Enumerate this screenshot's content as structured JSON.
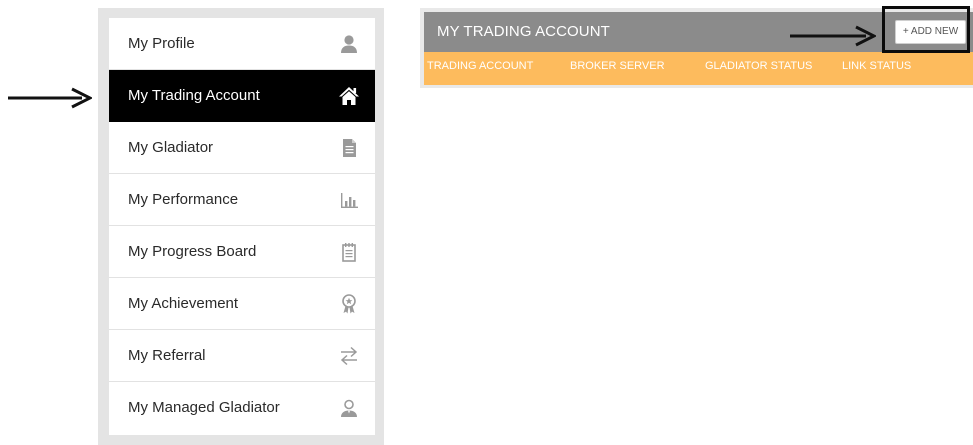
{
  "sidebar": {
    "items": [
      {
        "label": "My Profile",
        "icon": "user-icon",
        "active": false
      },
      {
        "label": "My Trading Account",
        "icon": "home-icon",
        "active": true
      },
      {
        "label": "My Gladiator",
        "icon": "document-icon",
        "active": false
      },
      {
        "label": "My Performance",
        "icon": "bar-chart-icon",
        "active": false
      },
      {
        "label": "My Progress Board",
        "icon": "notepad-icon",
        "active": false
      },
      {
        "label": "My Achievement",
        "icon": "award-ribbon-icon",
        "active": false
      },
      {
        "label": "My Referral",
        "icon": "transfer-arrows-icon",
        "active": false
      },
      {
        "label": "My Managed Gladiator",
        "icon": "manager-icon",
        "active": false
      }
    ]
  },
  "panel": {
    "title": "MY TRADING ACCOUNT",
    "add_new_label": "+ ADD NEW",
    "columns": [
      "TRADING ACCOUNT",
      "BROKER SERVER",
      "GLADIATOR STATUS",
      "LINK STATUS"
    ]
  },
  "colors": {
    "active_item_bg": "#000000",
    "panel_header_bg": "#8b8b8b",
    "column_header_bg": "#fdbb5d",
    "icon_gray": "#9a9a9a"
  }
}
